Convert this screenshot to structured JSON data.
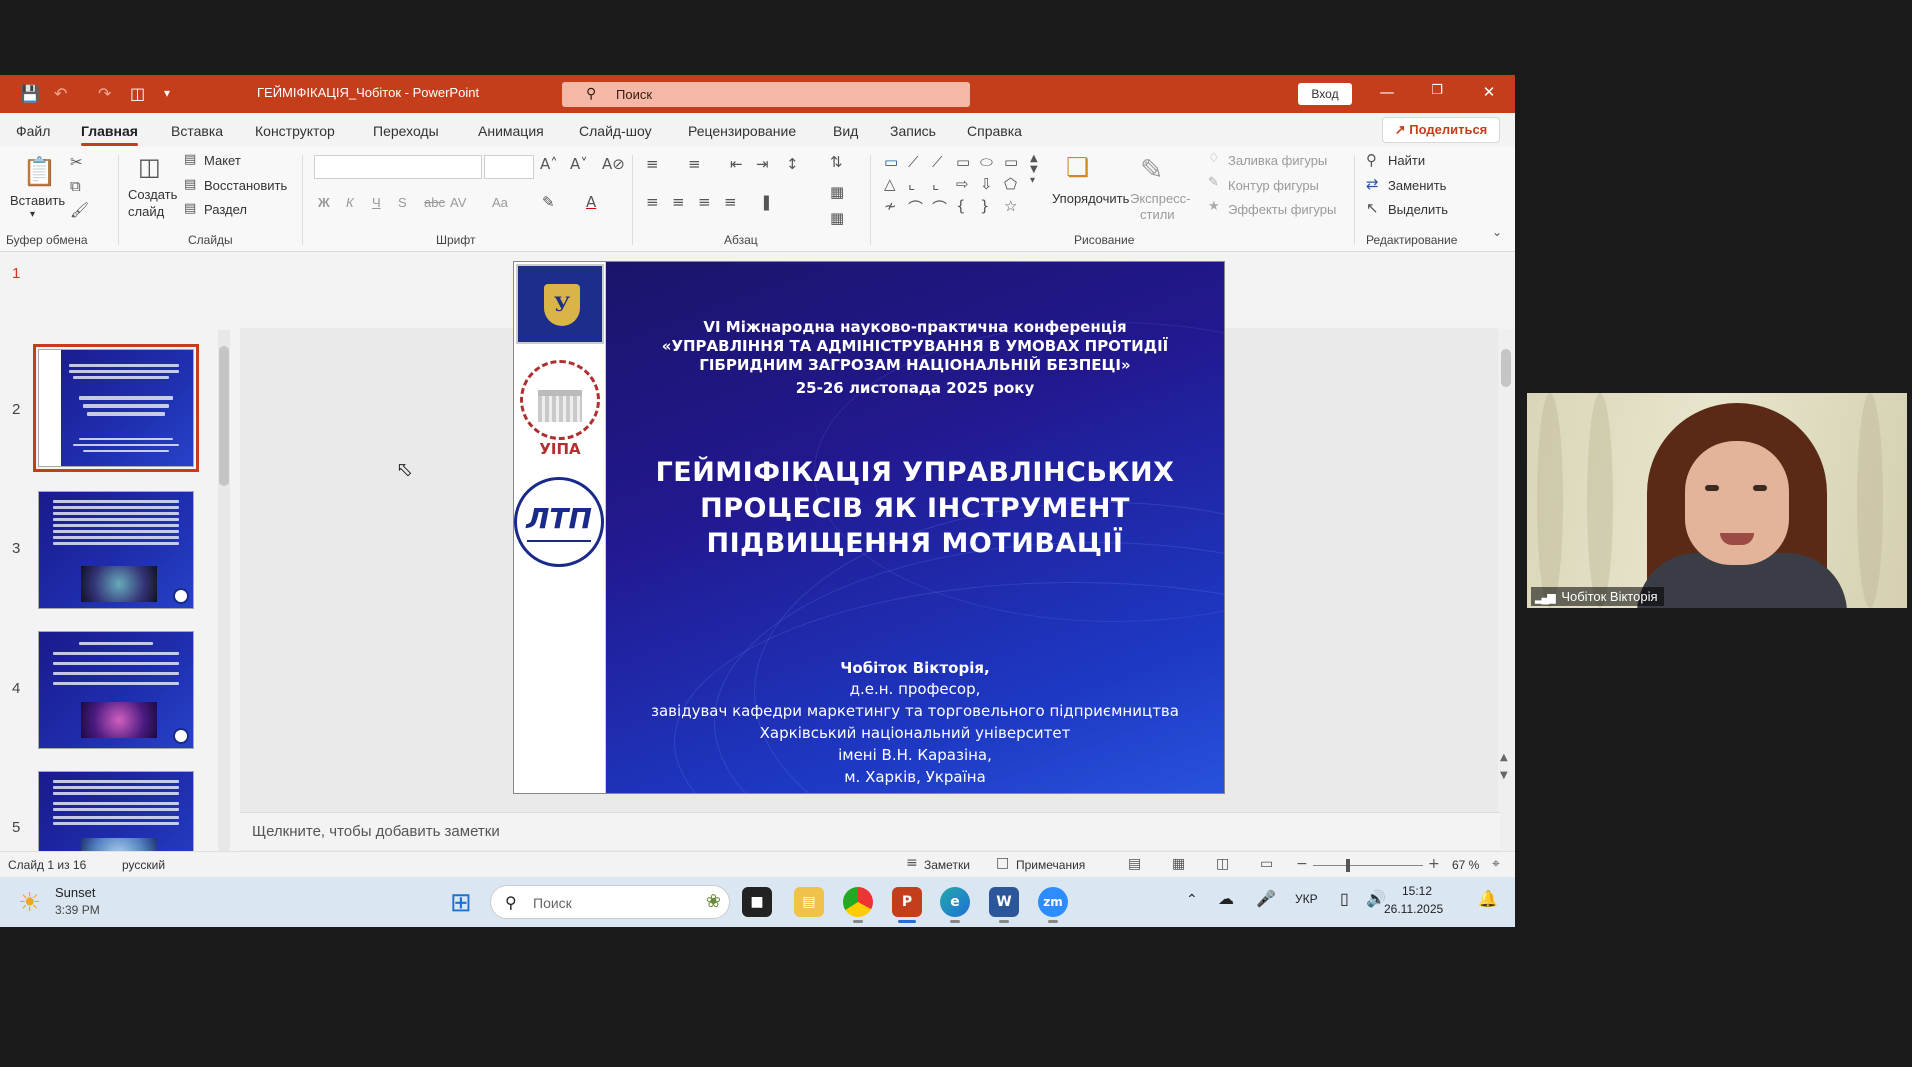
{
  "window": {
    "doc_title": "ГЕЙМІФІКАЦІЯ_Чобіток  -  PowerPoint",
    "search_placeholder": "Поиск",
    "signin_label": "Вход"
  },
  "menu": {
    "tabs": [
      "Файл",
      "Главная",
      "Вставка",
      "Конструктор",
      "Переходы",
      "Анимация",
      "Слайд-шоу",
      "Рецензирование",
      "Вид",
      "Запись",
      "Справка"
    ],
    "active_tab": "Главная",
    "share_label": "Поделиться"
  },
  "ribbon": {
    "clipboard": {
      "paste": "Вставить",
      "group": "Буфер обмена"
    },
    "slides": {
      "new_slide_1": "Создать",
      "new_slide_2": "слайд",
      "layout": "Макет",
      "reset": "Восстановить",
      "section": "Раздел",
      "group": "Слайды"
    },
    "font": {
      "group": "Шрифт",
      "bold": "Ж",
      "italic": "К",
      "underline": "Ч",
      "strike": "S",
      "spacing": "AV",
      "case": "Aa"
    },
    "paragraph": {
      "group": "Абзац"
    },
    "drawing": {
      "arrange": "Упорядочить",
      "quick_styles_1": "Экспресс-",
      "quick_styles_2": "стили",
      "fill": "Заливка фигуры",
      "outline": "Контур фигуры",
      "effects": "Эффекты фигуры",
      "group": "Рисование"
    },
    "editing": {
      "find": "Найти",
      "replace": "Заменить",
      "select": "Выделить",
      "group": "Редактирование"
    }
  },
  "thumbnails": {
    "numbers": [
      "1",
      "2",
      "3",
      "4",
      "5"
    ],
    "selected": 1
  },
  "slide": {
    "conference_line1": "VI Міжнародна науково-практична конференція",
    "conference_line2": "«УПРАВЛІННЯ ТА АДМІНІСТРУВАННЯ В УМОВАХ ПРОТИДІЇ",
    "conference_line3": "ГІБРИДНИМ ЗАГРОЗАМ НАЦІОНАЛЬНІЙ БЕЗПЕЦІ»",
    "conference_line4": "25-26 листопада 2025 року",
    "title_line1": "ГЕЙМІФІКАЦІЯ УПРАВЛІНСЬКИХ",
    "title_line2": "ПРОЦЕСІВ ЯК ІНСТРУМЕНТ",
    "title_line3": "ПІДВИЩЕННЯ МОТИВАЦІЇ",
    "author_name": "Чобіток Вікторія,",
    "author_line2": "д.е.н. професор,",
    "author_line3": "завідувач кафедри маркетингу та торговельного підприємництва",
    "author_line4": "Харківський національний університет",
    "author_line5": "імені В.Н. Каразіна,",
    "author_line6": "м. Харків, Україна",
    "logo_uipa": "УІПА",
    "logo_ltp": "ЛТП"
  },
  "notes_placeholder": "Щелкните, чтобы добавить заметки",
  "status": {
    "slide_counter": "Слайд 1 из 16",
    "language": "русский",
    "notes": "Заметки",
    "comments": "Примечания",
    "zoom": "67 %",
    "zoom_value_percent": 67
  },
  "taskbar": {
    "weather_title": "Sunset",
    "weather_time": "3:39 PM",
    "search_placeholder": "Поиск",
    "lang": "УКР",
    "clock_time": "15:12",
    "clock_date": "26.11.2025"
  },
  "webcam": {
    "participant_name": "Чобіток Вікторія"
  },
  "colors": {
    "accent": "#c43e1c",
    "slide_bg": "#1f2fb0"
  }
}
